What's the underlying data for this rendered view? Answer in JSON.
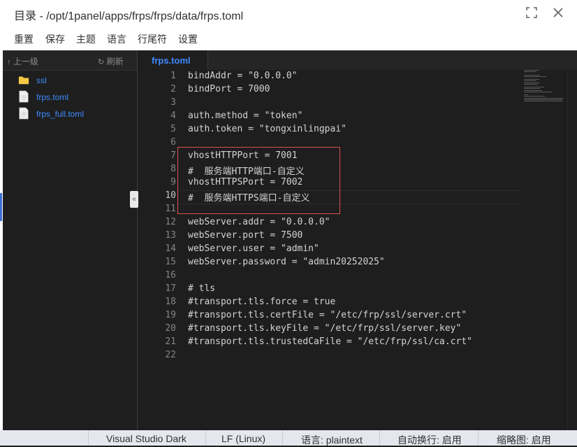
{
  "window": {
    "title": "目录 - /opt/1panel/apps/frps/frps/data/frps.toml",
    "maximize_icon": "maximize-icon",
    "close_icon": "close-icon"
  },
  "menu": [
    "重置",
    "保存",
    "主题",
    "语言",
    "行尾符",
    "设置"
  ],
  "sidebar": {
    "up_label": "上一级",
    "refresh_label": "刷新",
    "items": [
      {
        "label": "ssl",
        "type": "folder"
      },
      {
        "label": "frps.toml",
        "type": "file"
      },
      {
        "label": "frps_full.toml",
        "type": "file"
      }
    ],
    "collapse_glyph": "«"
  },
  "tabs": [
    {
      "label": "frps.toml"
    }
  ],
  "editor": {
    "current_line": 10,
    "lines": [
      "bindAddr = \"0.0.0.0\"",
      "bindPort = 7000",
      "",
      "auth.method = \"token\"",
      "auth.token = \"tongxinlingpai\"",
      "",
      "vhostHTTPPort = 7001",
      "#  服务端HTTP端口-自定义",
      "vhostHTTPSPort = 7002",
      "#  服务端HTTPS端口-自定义",
      "",
      "webServer.addr = \"0.0.0.0\"",
      "webServer.port = 7500",
      "webServer.user = \"admin\"",
      "webServer.password = \"admin20252025\"",
      "",
      "# tls",
      "#transport.tls.force = true",
      "#transport.tls.certFile = \"/etc/frp/ssl/server.crt\"",
      "#transport.tls.keyFile = \"/etc/frp/ssl/server.key\"",
      "#transport.tls.trustedCaFile = \"/etc/frp/ssl/ca.crt\"",
      ""
    ]
  },
  "status": {
    "theme": "Visual Studio Dark",
    "eol": "LF (Linux)",
    "language": "语言: plaintext",
    "wrap": "自动换行: 启用",
    "minimap": "缩略图: 启用"
  },
  "colors": {
    "accent": "#3d8bff",
    "highlight_box": "#d9534f",
    "editor_bg": "#1e1e1e"
  }
}
